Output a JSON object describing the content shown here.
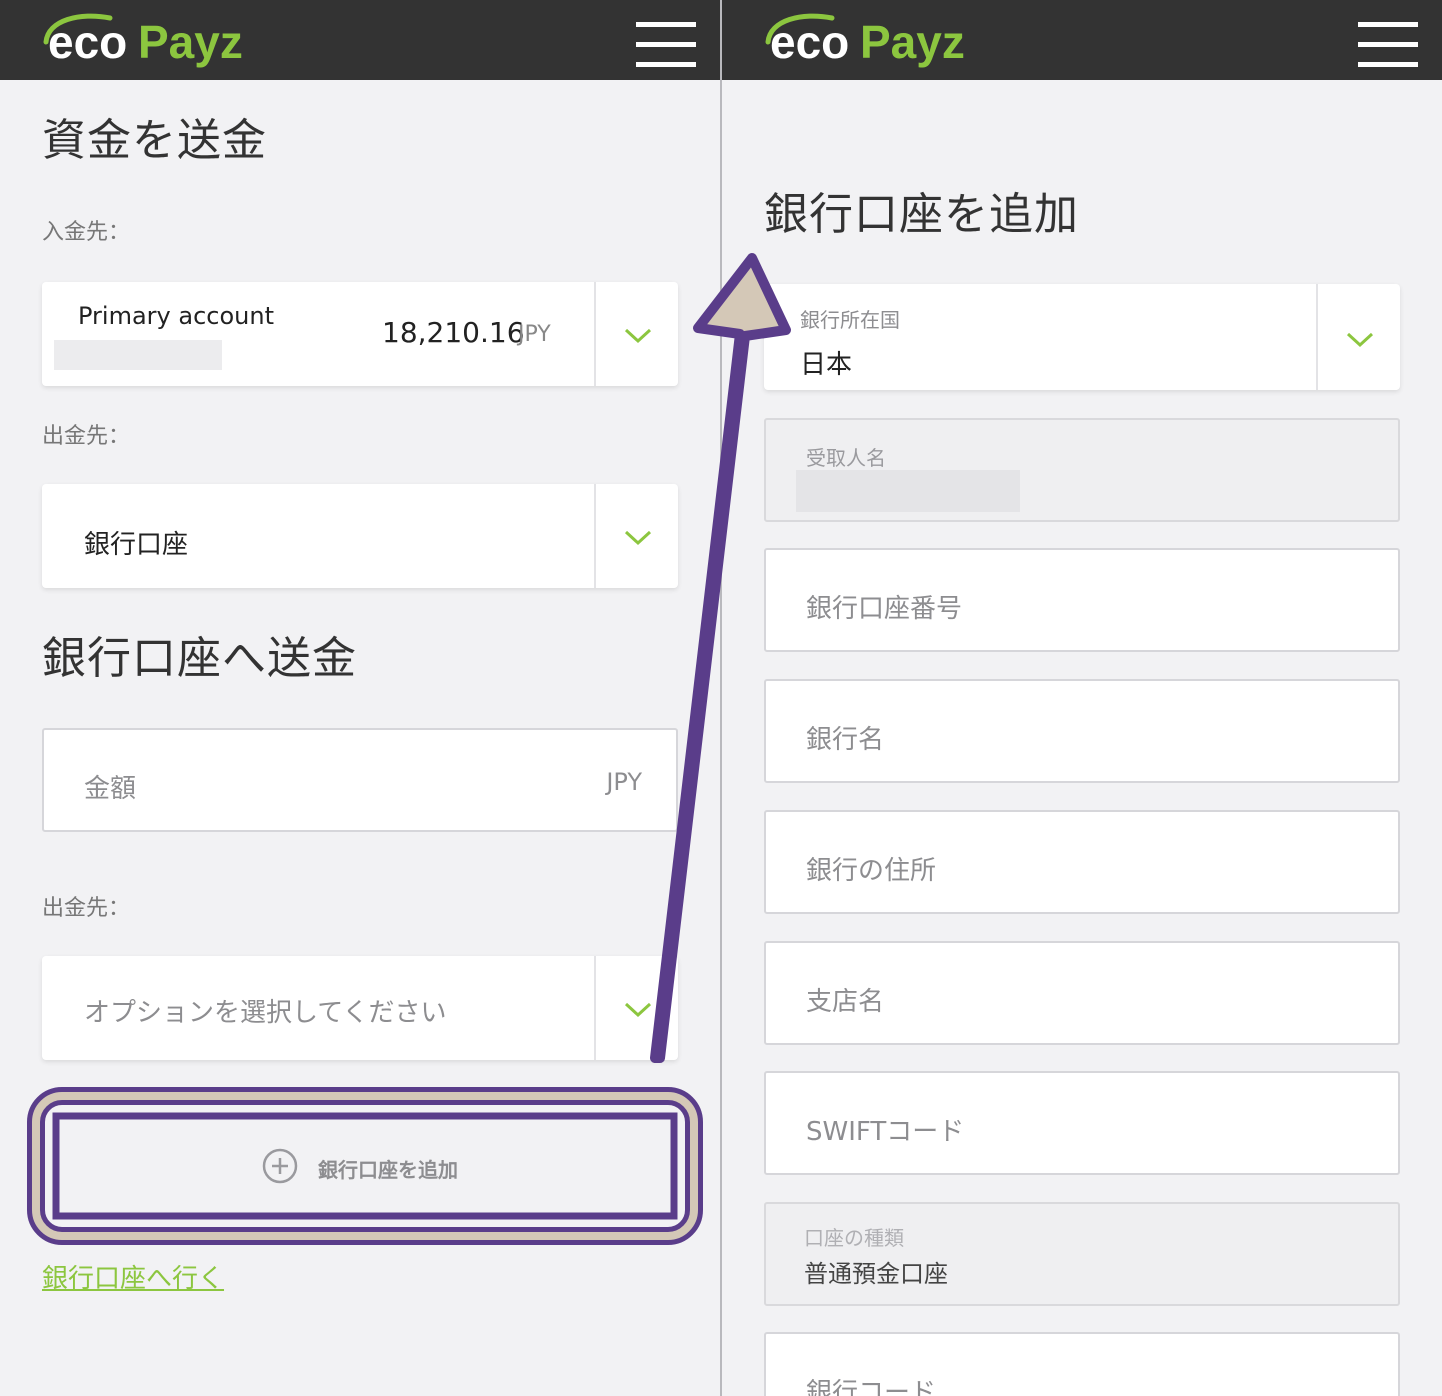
{
  "brand": {
    "eco": "eco",
    "payz": "Payz"
  },
  "left": {
    "title": "資金を送金",
    "to_label": "入金先：",
    "account": {
      "name": "Primary account",
      "balance": "18,210.16",
      "currency": "JPY"
    },
    "from_label": "出金先：",
    "from_value": "銀行口座",
    "section_title": "銀行口座へ送金",
    "amount": {
      "placeholder": "金額",
      "currency": "JPY"
    },
    "from_label2": "出金先：",
    "option_placeholder": "オプションを選択してください",
    "add_bank_label": "銀行口座を追加",
    "goto_bank_link": "銀行口座へ行く"
  },
  "right": {
    "title": "銀行口座を追加",
    "country": {
      "label": "銀行所在国",
      "value": "日本"
    },
    "recipient_label": "受取人名",
    "fields": [
      "銀行口座番号",
      "銀行名",
      "銀行の住所",
      "支店名",
      "SWIFTコード"
    ],
    "account_type": {
      "label": "口座の種類",
      "value": "普通預金口座"
    },
    "bank_code": "銀行コード"
  },
  "colors": {
    "accent_green": "#8cc63f",
    "highlight_purple": "#5a3d8a",
    "highlight_tan": "#d4c8b7",
    "topbar": "#333333"
  }
}
